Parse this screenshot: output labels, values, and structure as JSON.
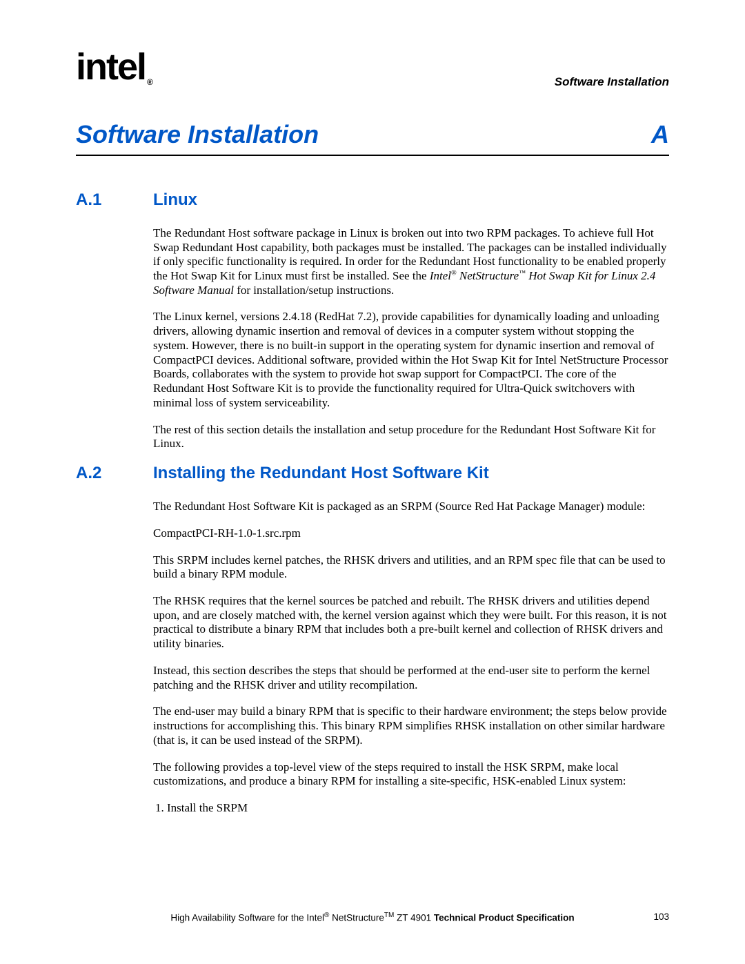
{
  "header": {
    "logo_text": "intel",
    "registered": "®",
    "section_label": "Software Installation"
  },
  "title": {
    "main": "Software Installation",
    "appendix": "A"
  },
  "sections": [
    {
      "num": "A.1",
      "heading": "Linux",
      "paragraphs": [
        {
          "runs": [
            {
              "text": "The Redundant Host software package in Linux is broken out into two RPM packages. To achieve full Hot Swap Redundant Host capability, both packages must be installed. The packages can be installed individually if only specific functionality is required. In order for the Redundant Host functionality to be enabled properly the Hot Swap Kit for Linux must first be installed. See the "
            },
            {
              "text": "Intel",
              "italic": true
            },
            {
              "text": "®",
              "sup": true,
              "italic": true
            },
            {
              "text": " NetStructure",
              "italic": true
            },
            {
              "text": "™",
              "sup": true,
              "italic": true
            },
            {
              "text": " Hot Swap Kit for Linux 2.4 Software Manual",
              "italic": true
            },
            {
              "text": " for installation/setup instructions."
            }
          ]
        },
        {
          "runs": [
            {
              "text": "The Linux kernel, versions 2.4.18 (RedHat 7.2), provide capabilities for dynamically loading and unloading drivers, allowing dynamic insertion and removal of devices in a computer system without stopping the system. However, there is no built-in support in the operating system for dynamic insertion and removal of CompactPCI devices. Additional software, provided within the Hot Swap Kit for Intel NetStructure Processor Boards, collaborates with the system to provide hot swap support for CompactPCI. The core of the Redundant Host Software Kit is to provide the functionality required for Ultra-Quick switchovers with minimal loss of system serviceability."
            }
          ]
        },
        {
          "runs": [
            {
              "text": "The rest of this section details the installation and setup procedure for the Redundant Host Software Kit for Linux."
            }
          ]
        }
      ]
    },
    {
      "num": "A.2",
      "heading": "Installing the Redundant Host Software Kit",
      "paragraphs": [
        {
          "runs": [
            {
              "text": "The Redundant Host Software Kit is packaged as an SRPM (Source Red Hat Package Manager) module:"
            }
          ]
        },
        {
          "runs": [
            {
              "text": "CompactPCI-RH-1.0-1.src.rpm"
            }
          ]
        },
        {
          "runs": [
            {
              "text": "This SRPM includes kernel patches, the RHSK drivers and utilities, and an RPM spec file that can be used to build a binary RPM module."
            }
          ]
        },
        {
          "runs": [
            {
              "text": "The RHSK requires that the kernel sources be patched and rebuilt. The RHSK drivers and utilities depend upon, and are closely matched with, the kernel version against which they were built. For this reason, it is not practical to distribute a binary RPM that includes both a pre-built kernel and collection of RHSK drivers and utility binaries."
            }
          ]
        },
        {
          "runs": [
            {
              "text": "Instead, this section describes the steps that should be performed at the end-user site to perform the kernel patching and the RHSK driver and utility recompilation."
            }
          ]
        },
        {
          "runs": [
            {
              "text": "The end-user may build a binary RPM that is specific to their hardware environment; the steps below provide instructions for accomplishing this. This binary RPM simplifies RHSK installation on other similar hardware (that is, it can be used instead of the SRPM)."
            }
          ]
        },
        {
          "runs": [
            {
              "text": "The following provides a top-level view of the steps required to install the HSK SRPM, make local customizations, and produce a binary RPM for installing a site-specific, HSK-enabled Linux system:"
            }
          ]
        }
      ],
      "list": [
        "Install the SRPM"
      ]
    }
  ],
  "footer": {
    "prefix": "High Availability Software for the Intel",
    "reg": "®",
    "mid": " NetStructure",
    "tm": "TM",
    "model": " ZT 4901 ",
    "bold": "Technical Product Specification",
    "page": "103"
  }
}
